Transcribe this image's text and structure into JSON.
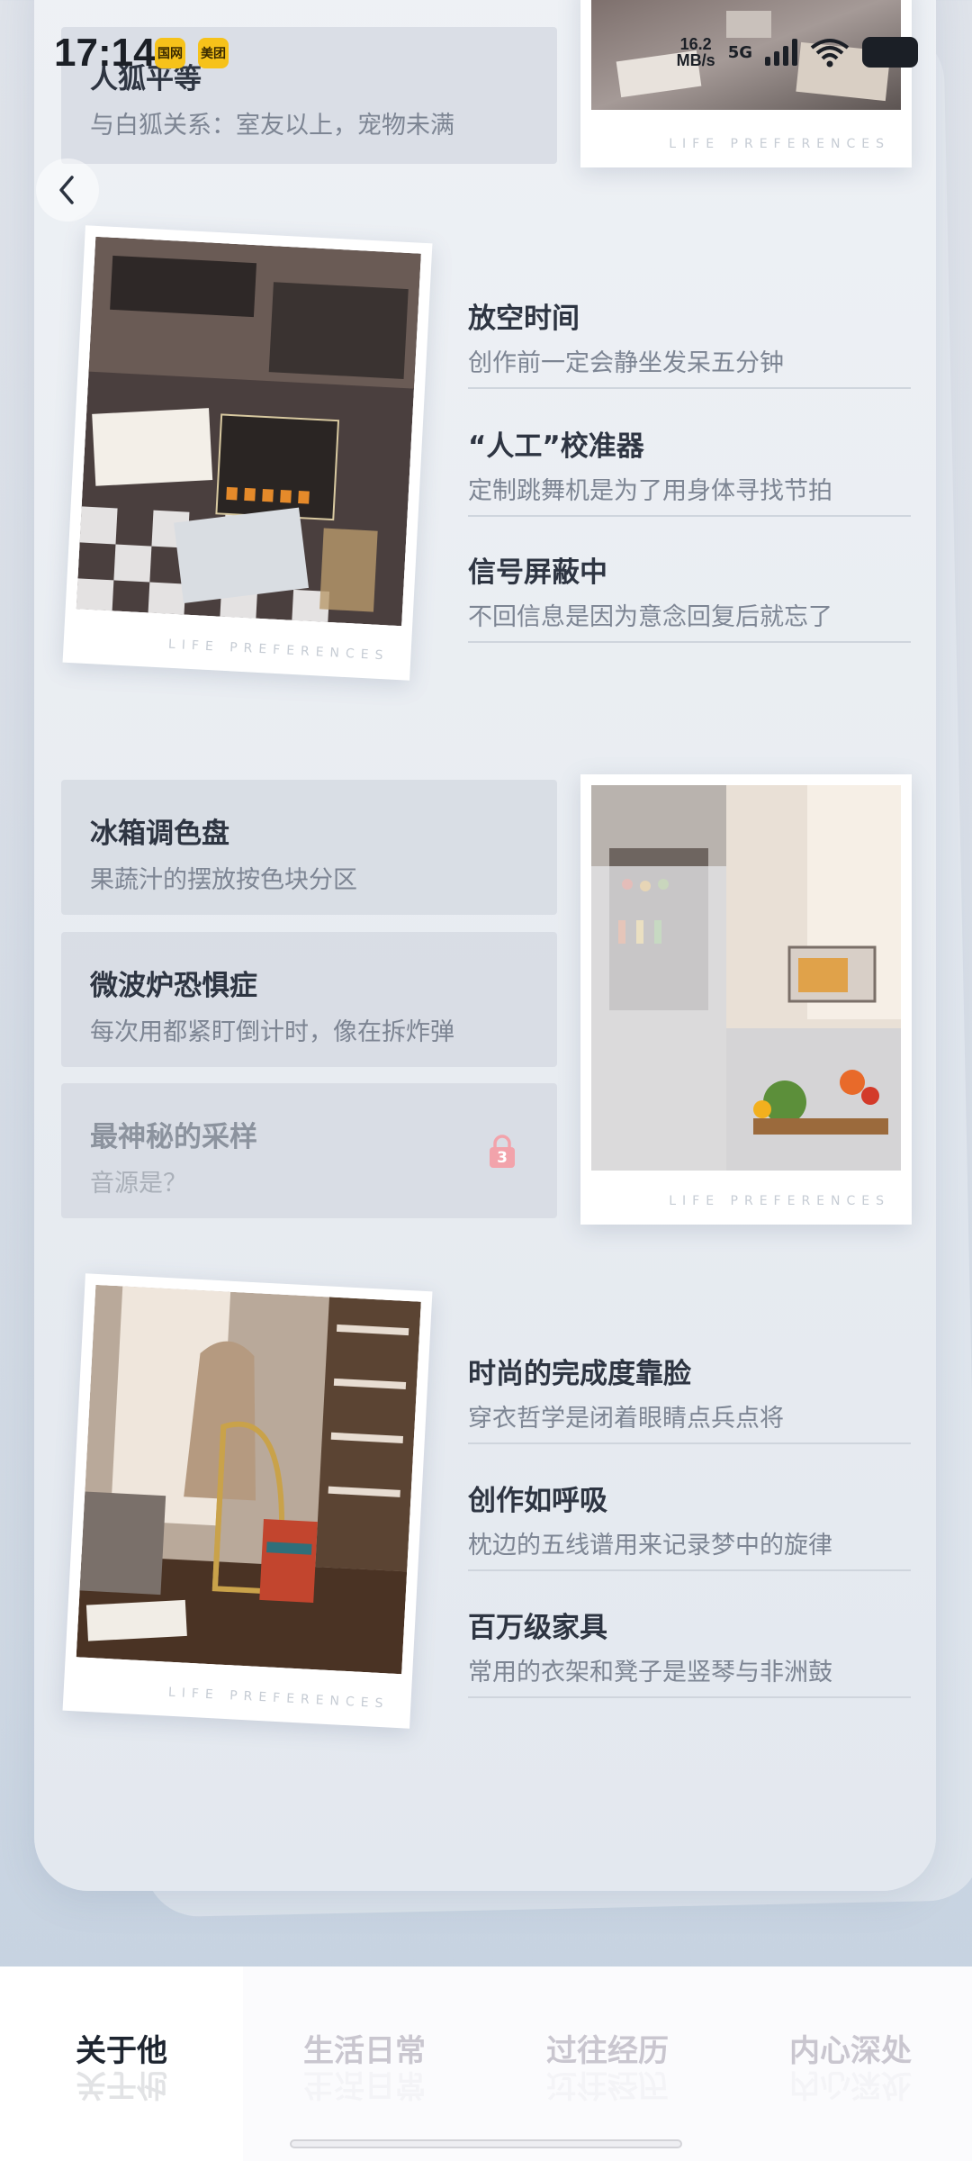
{
  "status_bar": {
    "time": "17:14",
    "badges": [
      "国网",
      "美团"
    ],
    "net_speed_value": "16.2",
    "net_speed_unit": "MB/s",
    "net_type": "5G"
  },
  "top_item": {
    "title": "人狐平等",
    "subtitle": "与白狐关系：室友以上，宠物未满"
  },
  "caption": "LIFE PREFERENCES",
  "section1": {
    "items": [
      {
        "title": "放空时间",
        "subtitle": "创作前一定会静坐发呆五分钟"
      },
      {
        "title": "“人工”校准器",
        "subtitle": "定制跳舞机是为了用身体寻找节拍"
      },
      {
        "title": "信号屏蔽中",
        "subtitle": "不回信息是因为意念回复后就忘了"
      }
    ]
  },
  "section2": {
    "items": [
      {
        "title": "冰箱调色盘",
        "subtitle": "果蔬汁的摆放按色块分区"
      },
      {
        "title": "微波炉恐惧症",
        "subtitle": "每次用都紧盯倒计时，像在拆炸弹"
      },
      {
        "title": "最神秘的采样",
        "subtitle": "音源是？",
        "lock_number": "3"
      }
    ]
  },
  "section3": {
    "items": [
      {
        "title": "时尚的完成度靠脸",
        "subtitle": "穿衣哲学是闭着眼睛点兵点将"
      },
      {
        "title": "创作如呼吸",
        "subtitle": "枕边的五线谱用来记录梦中的旋律"
      },
      {
        "title": "百万级家具",
        "subtitle": "常用的衣架和凳子是竖琴与非洲鼓"
      }
    ]
  },
  "tabs": [
    {
      "label": "关于他",
      "active": true
    },
    {
      "label": "生活日常",
      "active": false
    },
    {
      "label": "过往经历",
      "active": false
    },
    {
      "label": "内心深处",
      "active": false
    }
  ],
  "colors": {
    "lock_pink": "#f2a3ab",
    "accent_text": "#2e3542"
  }
}
